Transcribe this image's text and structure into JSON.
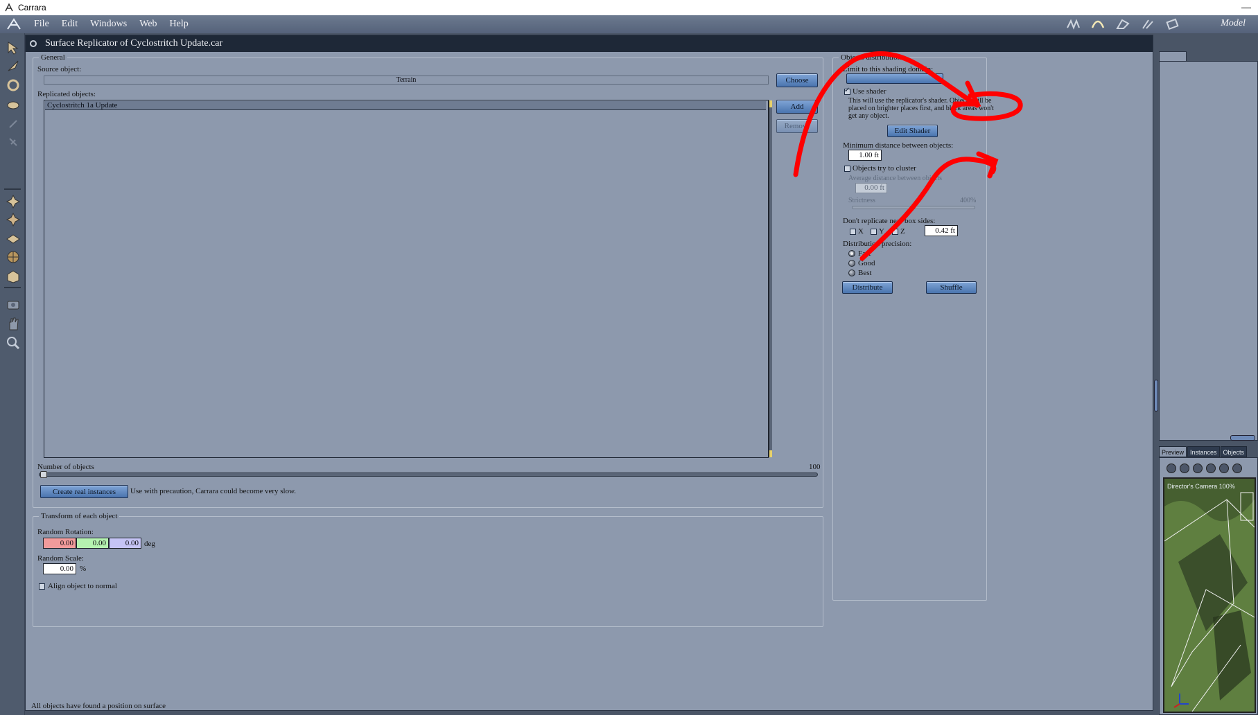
{
  "window": {
    "title": "Carrara"
  },
  "menu": {
    "items": [
      "File",
      "Edit",
      "Windows",
      "Web",
      "Help"
    ],
    "room": "Model"
  },
  "document": {
    "title": "Surface Replicator of Cyclostritch Update.car"
  },
  "general": {
    "title": "General",
    "source_label": "Source object:",
    "source_value": "Terrain",
    "choose_label": "Choose",
    "replicated_label": "Replicated objects:",
    "replicated_items": [
      "Cyclostritch 1a Update"
    ],
    "add_label": "Add",
    "remove_label": "Remove",
    "count_label": "Number of objects",
    "count_max": "100",
    "count_value": 0,
    "create_instances_label": "Create real instances",
    "precaution_text": "Use with precaution, Carrara could become very slow."
  },
  "transform": {
    "title": "Transform of each object",
    "rotation_label": "Random Rotation:",
    "rotation_values": [
      "0.00",
      "0.00",
      "0.00"
    ],
    "rotation_unit": "deg",
    "scale_label": "Random Scale:",
    "scale_value": "0.00",
    "scale_unit": "%",
    "align_label": "Align object to normal"
  },
  "status_text": "All objects have found a position on surface",
  "distribution": {
    "title": "Objects distribution",
    "domain_label": "Limit to this shading domain:",
    "use_shader_label": "Use shader",
    "shader_desc_1": "This will use the replicator's shader. Objects will be",
    "shader_desc_2": "placed on brighter places first, and black areas won't",
    "shader_desc_3": "get any object.",
    "edit_shader_label": "Edit Shader",
    "min_distance_label": "Minimum distance between objects:",
    "min_distance_value": "1.00 ft",
    "cluster_label": "Objects try to cluster",
    "avg_distance_label": "Average distance between objects",
    "avg_distance_value": "0.00 ft",
    "strictness_label": "Strictness",
    "strictness_value": "400%",
    "box_sides_label": "Don't replicate near box sides:",
    "axis_x": "X",
    "axis_y": "Y",
    "axis_z": "Z",
    "box_distance_value": "0.42 ft",
    "precision_label": "Distribution precision:",
    "precision_fast": "Fast",
    "precision_good": "Good",
    "precision_best": "Best",
    "distribute_label": "Distribute",
    "shuffle_label": "Shuffle"
  },
  "side_tabs": [
    "Preview",
    "Instances",
    "Objects"
  ],
  "viewport_label": "Director's Camera 100%",
  "colors": {
    "rot_x": "#f29b9b",
    "rot_y": "#b5f2b0",
    "rot_z": "#c5c4f5",
    "annotation": "#ff0000"
  }
}
